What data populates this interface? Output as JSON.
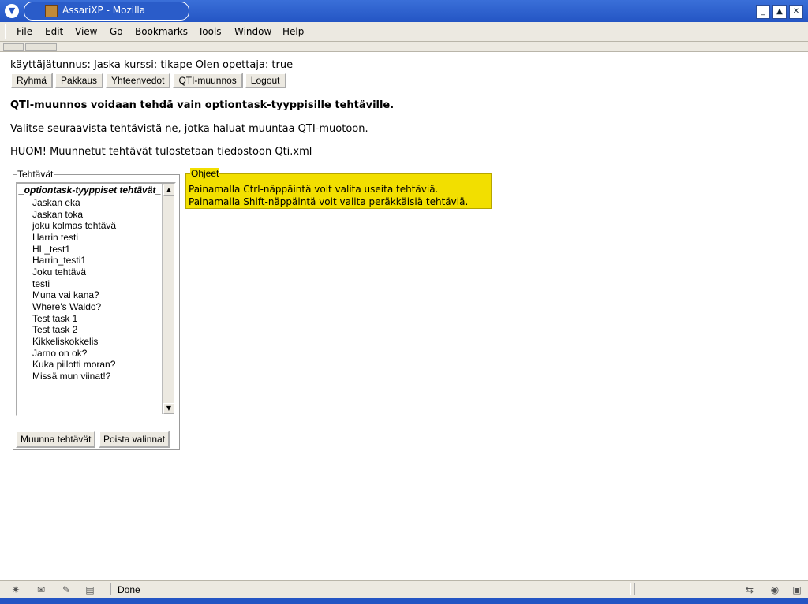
{
  "window": {
    "title": "AssariXP - Mozilla",
    "controls": {
      "minimize": "_",
      "maximize": "▲",
      "close": "✕"
    }
  },
  "menubar": {
    "items": [
      {
        "label": "File"
      },
      {
        "label": "Edit"
      },
      {
        "label": "View"
      },
      {
        "label": "Go"
      },
      {
        "label": "Bookmarks"
      },
      {
        "label": "Tools"
      },
      {
        "label": "Window"
      },
      {
        "label": "Help"
      }
    ]
  },
  "page": {
    "userline": "käyttäjätunnus: Jaska kurssi: tikape Olen opettaja: true",
    "nav_buttons": [
      {
        "label": "Ryhmä"
      },
      {
        "label": "Pakkaus"
      },
      {
        "label": "Yhteenvedot"
      },
      {
        "label": "QTI-muunnos"
      },
      {
        "label": "Logout"
      }
    ],
    "heading": "QTI-muunnos voidaan tehdä vain optiontask-tyyppisille tehtäville.",
    "instruction": "Valitse seuraavista tehtävistä ne, jotka haluat muuntaa QTI-muotoon.",
    "note": "HUOM! Muunnetut tehtävät tulostetaan tiedostoon Qti.xml"
  },
  "tasks": {
    "legend": "Tehtävät",
    "group_header": "_optiontask-tyyppiset tehtävät_",
    "items": [
      {
        "label": "Jaskan eka"
      },
      {
        "label": "Jaskan toka"
      },
      {
        "label": "joku kolmas tehtävä"
      },
      {
        "label": "Harrin testi"
      },
      {
        "label": "HL_test1"
      },
      {
        "label": "Harrin_testi1"
      },
      {
        "label": "Joku tehtävä"
      },
      {
        "label": "testi"
      },
      {
        "label": "Muna vai kana?"
      },
      {
        "label": "Where's Waldo?"
      },
      {
        "label": "Test task 1"
      },
      {
        "label": "Test task 2"
      },
      {
        "label": "Kikkeliskokkelis"
      },
      {
        "label": "Jarno on ok?"
      },
      {
        "label": "Kuka piilotti moran?"
      },
      {
        "label": "Missä mun viinat!?"
      }
    ],
    "convert_button": "Muunna tehtävät",
    "clear_button": "Poista valinnat"
  },
  "help": {
    "legend": "Ohjeet",
    "lines": [
      "Painamalla Ctrl-näppäintä voit valita useita tehtäviä.",
      "Painamalla Shift-näppäintä voit valita peräkkäisiä tehtäviä."
    ],
    "background": "#f2df00"
  },
  "statusbar": {
    "text": "Done",
    "icons": [
      "navigator-icon",
      "mail-icon",
      "composer-icon",
      "addressbook-icon",
      "online-icon",
      "security-icon",
      "lock-icon"
    ]
  },
  "colors": {
    "titlebar": "#2455c4",
    "chrome": "#ece9e1"
  }
}
